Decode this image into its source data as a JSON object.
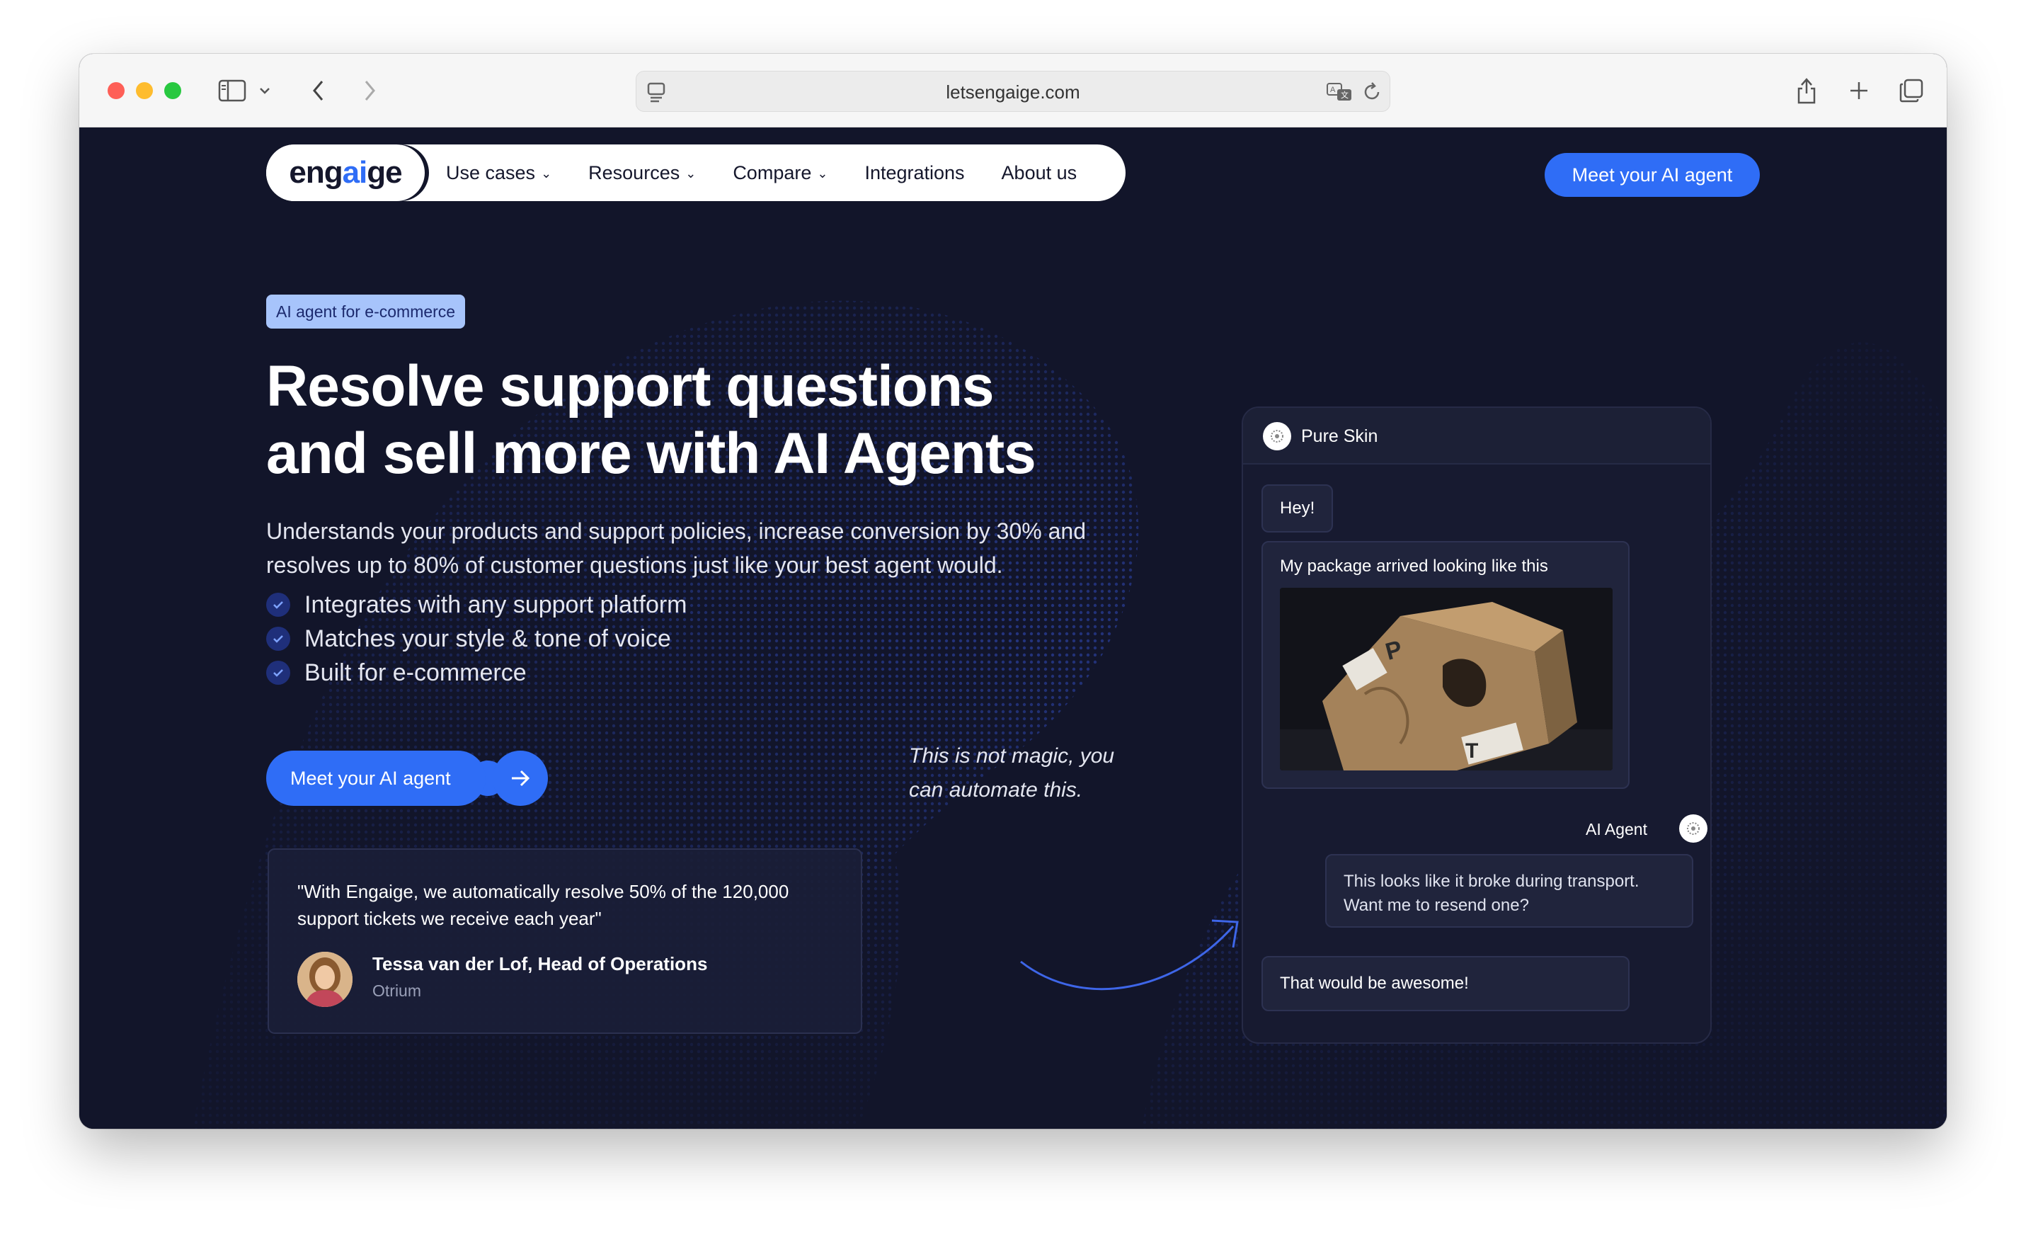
{
  "browser": {
    "url": "letsengaige.com",
    "icons": [
      "sidebar-icon",
      "chevron-down-icon",
      "back-icon",
      "forward-icon",
      "page-icon",
      "translate-icon",
      "reload-icon",
      "share-icon",
      "new-tab-icon",
      "tabs-overview-icon"
    ]
  },
  "nav": {
    "logo": {
      "pre": "eng",
      "ai": "ai",
      "post": "ge"
    },
    "items": [
      {
        "label": "Use cases",
        "has_dropdown": true
      },
      {
        "label": "Resources",
        "has_dropdown": true
      },
      {
        "label": "Compare",
        "has_dropdown": true
      },
      {
        "label": "Integrations",
        "has_dropdown": false
      },
      {
        "label": "About us",
        "has_dropdown": false
      }
    ],
    "cta": "Meet your AI agent"
  },
  "hero": {
    "badge": "AI agent for e-commerce",
    "headline_line1": "Resolve support questions",
    "headline_line2": "and sell more with AI Agents",
    "subtext": "Understands your products and support policies, increase conversion by 30% and resolves up to 80% of customer questions just like your best agent would.",
    "checks": [
      "Integrates with any support platform",
      "Matches your style & tone of voice",
      "Built for e-commerce"
    ],
    "cta": "Meet your AI agent",
    "magic_note": "This is not magic, you can automate this."
  },
  "testimonial": {
    "quote": "\"With Engaige, we automatically resolve 50% of the 120,000 support tickets we receive each year\"",
    "name": "Tessa van der Lof, Head of Operations",
    "company": "Otrium"
  },
  "chat": {
    "brand": "Pure Skin",
    "messages": {
      "hey": "Hey!",
      "package": "My package arrived looking like this",
      "agent_label": "AI Agent",
      "agent_reply": "This looks like it broke during transport. Want me to resend one?",
      "awesome": "That would be awesome!"
    }
  },
  "colors": {
    "accent": "#2f6df6",
    "page_bg": "#12152a",
    "badge_bg": "#a7c4fb"
  }
}
